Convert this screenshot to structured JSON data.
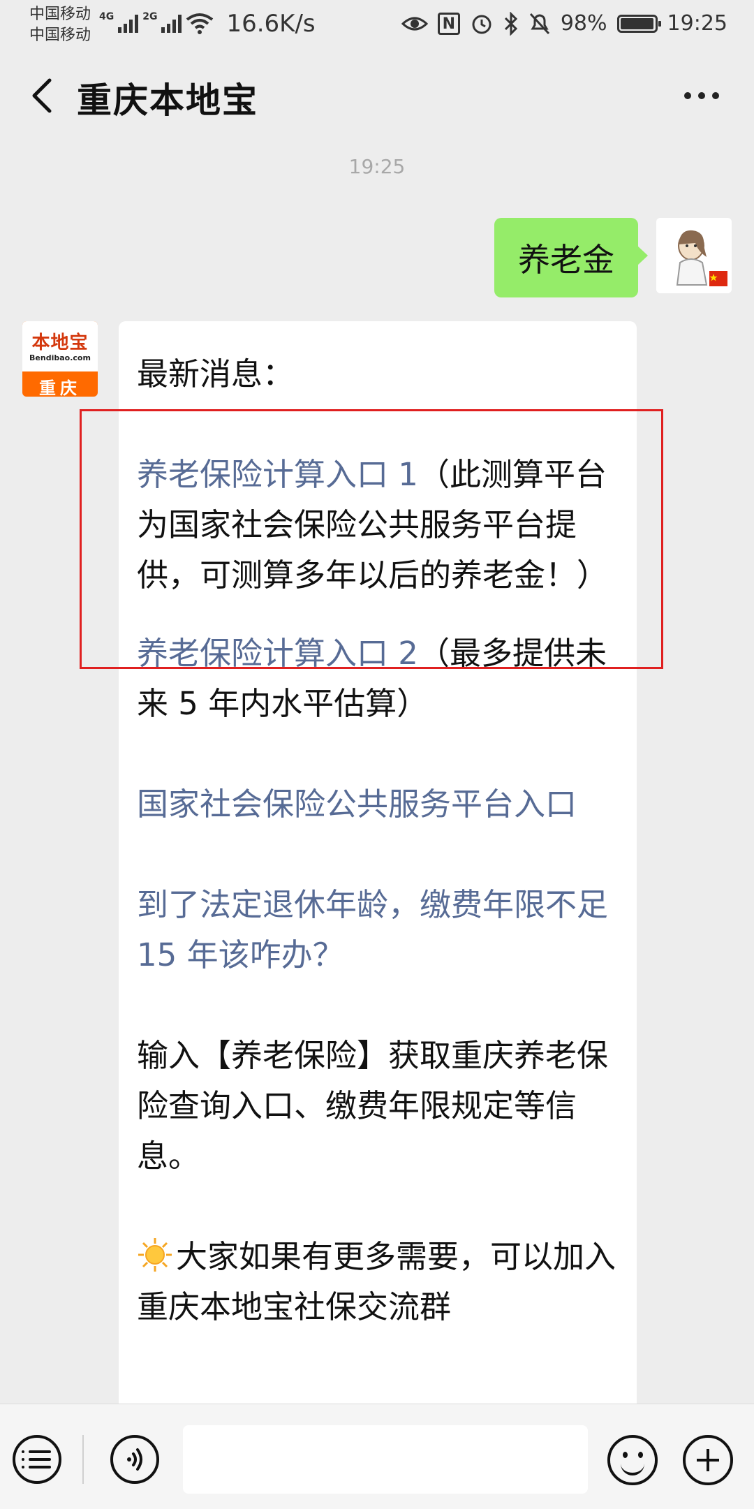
{
  "status_bar": {
    "carrier_1": "中国移动",
    "carrier_2": "中国移动",
    "network_1": "4G",
    "network_2": "2G",
    "speed": "16.6K/s",
    "nfc": "N",
    "battery": "98%",
    "battery_level": 0.98,
    "time": "19:25"
  },
  "header": {
    "title": "重庆本地宝",
    "back_icon": "back-arrow-icon",
    "more_icon": "more-dots-icon"
  },
  "chat": {
    "timestamp": "19:25",
    "outgoing": {
      "text": "养老金"
    },
    "incoming": {
      "avatar": {
        "brand": "本地宝",
        "domain": "Bendibao.com",
        "city": "重庆"
      },
      "intro": "最新消息：",
      "item1_link": "养老保险计算入口 1",
      "item1_text": "（此测算平台为国家社会保险公共服务平台提供，可测算多年以后的养老金！）",
      "item2_link": "养老保险计算入口 2",
      "item2_text": "（最多提供未来 5 年内水平估算）",
      "item3_link": "国家社会保险公共服务平台入口",
      "item4_link": "到了法定退休年龄，缴费年限不足 15 年该咋办？",
      "tip": "输入【养老保险】获取重庆养老保险查询入口、缴费年限规定等信息。",
      "promo": "大家如果有更多需要，可以加入重庆本地宝社保交流群"
    }
  },
  "input_bar": {
    "menu_icon": "menu-list-icon",
    "voice_icon": "voice-icon",
    "input_value": "",
    "emoji_icon": "emoji-icon",
    "plus_icon": "plus-icon"
  },
  "colors": {
    "background": "#ededed",
    "outgoing_bubble": "#95ec69",
    "link": "#576b95",
    "highlight": "#e02020",
    "brand_orange": "#ff6a00"
  }
}
